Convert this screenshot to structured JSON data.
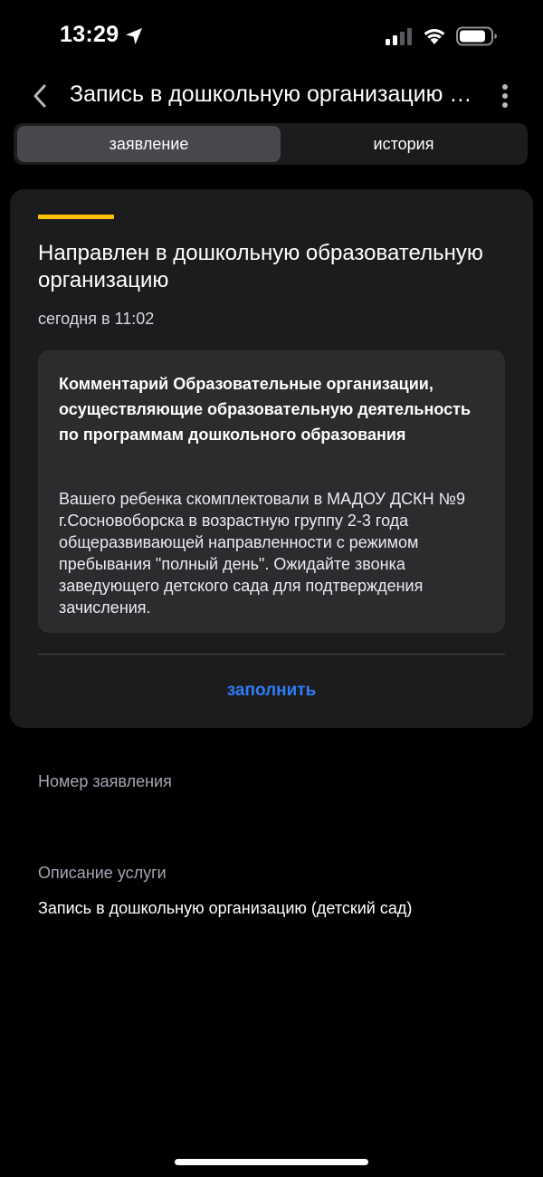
{
  "status_bar": {
    "time": "13:29",
    "icons": [
      "location-arrow-icon",
      "cellular-signal-icon",
      "wifi-icon",
      "battery-icon"
    ]
  },
  "header": {
    "title": "Запись в дошкольную организацию (детский сад)",
    "back_icon": "chevron-left-icon",
    "more_icon": "vertical-ellipsis-icon"
  },
  "tabs": [
    {
      "label": "заявление",
      "active": true
    },
    {
      "label": "история",
      "active": false
    }
  ],
  "status_card": {
    "accent_color": "#ffc000",
    "title": "Направлен в дошкольную образовательную организацию",
    "timestamp": "сегодня в 11:02",
    "comment": {
      "title": "Комментарий Образовательные организации, осуществляющие образовательную деятельность по программам дошкольного образования",
      "text": "Вашего ребенка скомплектовали в МАДОУ ДСКН №9 г.Сосновоборска в возрастную группу 2-3 года общеразвивающей направленности с режимом пребывания \"полный день\". Ожидайте звонка заведующего детского сада для подтверждения зачисления."
    },
    "action_label": "заполнить",
    "action_color": "#2f7cf6"
  },
  "details": {
    "application_number_label": "Номер заявления",
    "application_number_value": "",
    "service_description_label": "Описание услуги",
    "service_description_value": "Запись в дошкольную организацию (детский сад)"
  },
  "theme": {
    "background": "#000000",
    "card_background": "#1c1c1e",
    "comment_background": "#2c2c2e",
    "label_color": "#a5a5b4"
  }
}
